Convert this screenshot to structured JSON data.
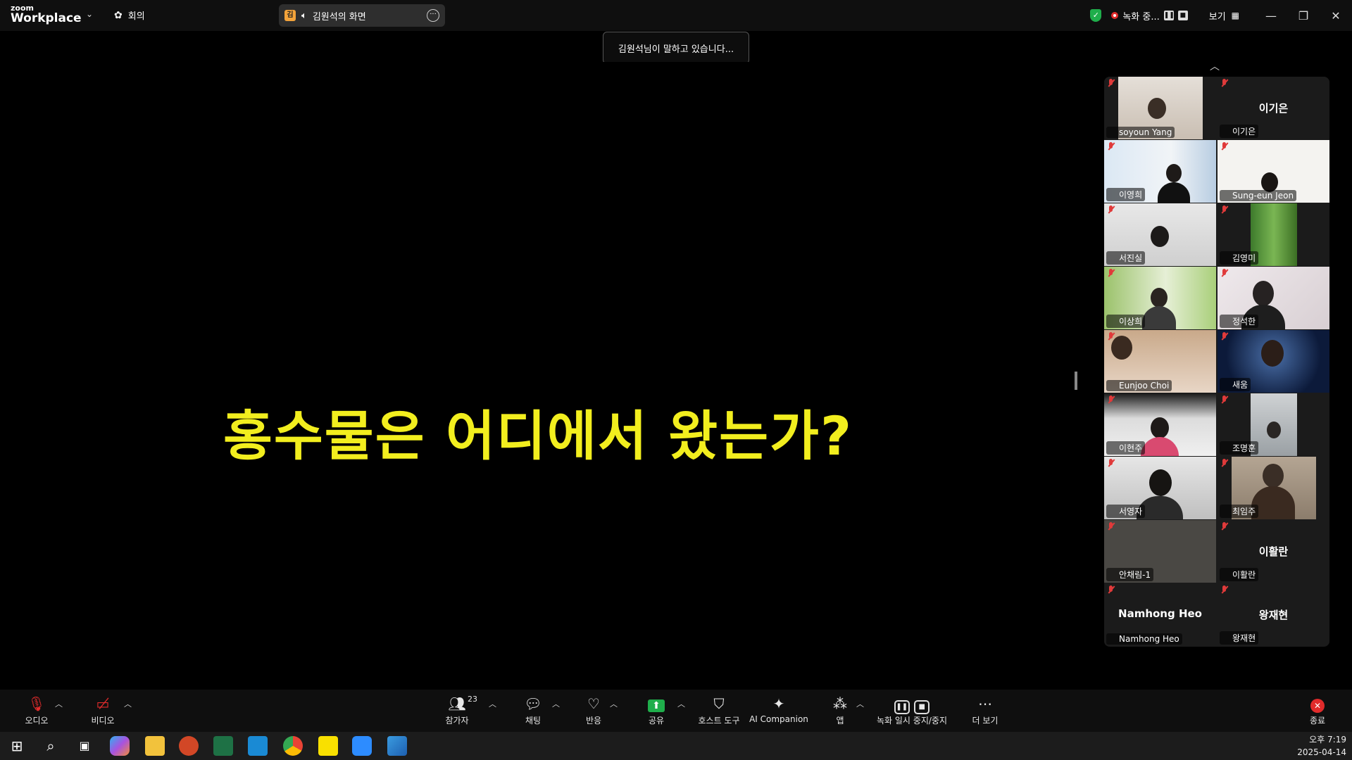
{
  "app": {
    "logo_small": "zoom",
    "logo_big": "Workplace",
    "meeting_label": "회의"
  },
  "share_pill": {
    "badge": "김",
    "label": "김원석의 화면"
  },
  "top_right": {
    "recording_label": "녹화 중...",
    "view_label": "보기"
  },
  "speaking_toast": "김원석님이 말하고 있습니다...",
  "slide": {
    "title": "홍수물은 어디에서 왔는가?",
    "title_color": "#f2ee1e"
  },
  "participants": [
    {
      "name": "soyoun Yang",
      "video": true
    },
    {
      "name": "이기은",
      "video": false,
      "display": "이기은"
    },
    {
      "name": "이영희",
      "video": true
    },
    {
      "name": "Sung-eun Jeon",
      "video": true
    },
    {
      "name": "서진실",
      "video": true
    },
    {
      "name": "김영미",
      "video": true
    },
    {
      "name": "이상희",
      "video": true
    },
    {
      "name": "정석한",
      "video": true
    },
    {
      "name": "Eunjoo Choi",
      "video": true
    },
    {
      "name": "새움",
      "video": true
    },
    {
      "name": "이현주",
      "video": true
    },
    {
      "name": "조명훈",
      "video": true
    },
    {
      "name": "서영자",
      "video": true
    },
    {
      "name": "최임주",
      "video": true
    },
    {
      "name": "안채림-1",
      "video": true
    },
    {
      "name": "이활란",
      "video": false,
      "display": "이활란"
    },
    {
      "name": "Namhong Heo",
      "video": false,
      "display": "Namhong Heo"
    },
    {
      "name": "왕재현",
      "video": false,
      "display": "왕재현"
    }
  ],
  "toolbar": {
    "audio": "오디오",
    "video": "비디오",
    "participants": "참가자",
    "participant_count": "23",
    "chat": "채팅",
    "reactions": "반응",
    "share": "공유",
    "host_tools": "호스트 도구",
    "ai_companion": "AI Companion",
    "apps": "앱",
    "recording": "녹화 일시 중지/중지",
    "more": "더 보기",
    "end": "종료"
  },
  "clock": {
    "time": "오후 7:19",
    "date": "2025-04-14"
  },
  "colors": {
    "accent_green": "#1fae4b",
    "end_red": "#e02b2b"
  }
}
